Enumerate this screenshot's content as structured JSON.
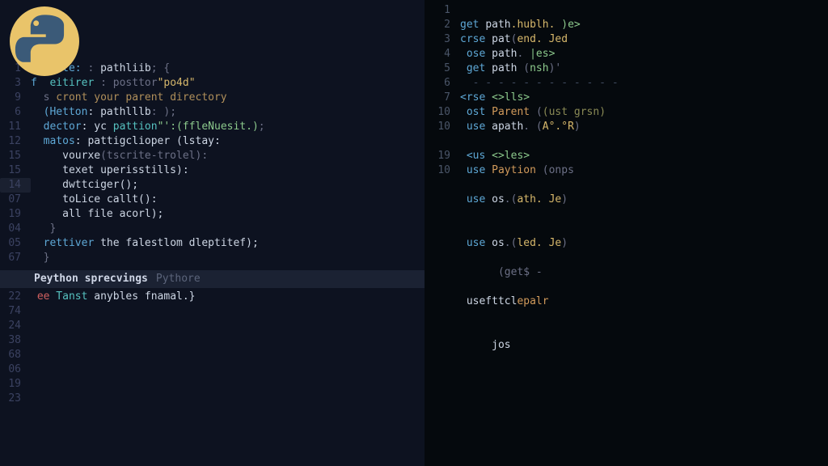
{
  "logo": {
    "name": "python-logo"
  },
  "left": {
    "lines": [
      {
        "n": "",
        "frags": []
      },
      {
        "n": "1",
        "frags": [
          {
            "t": "  rnute:",
            "c": "c-blue"
          },
          {
            "t": " :",
            "c": "c-grey"
          },
          {
            "t": " pathliib",
            "c": "c-white"
          },
          {
            "t": "; {",
            "c": "c-grey"
          }
        ]
      },
      {
        "n": "3",
        "frags": [
          {
            "t": "f",
            "c": "c-blue"
          },
          {
            "t": "  eitirer",
            "c": "c-cyan"
          },
          {
            "t": " : posttor",
            "c": "c-grey"
          },
          {
            "t": "\"po4d\"",
            "c": "c-yellow"
          }
        ]
      },
      {
        "n": "9",
        "frags": [
          {
            "t": "  s",
            "c": "c-grey"
          },
          {
            "t": " cront your parent directory",
            "c": "c-tan"
          }
        ]
      },
      {
        "n": "6",
        "frags": [
          {
            "t": "  (Hetton",
            "c": "c-blue"
          },
          {
            "t": ": pathlllb",
            "c": "c-white"
          },
          {
            "t": ": );",
            "c": "c-grey"
          }
        ]
      },
      {
        "n": "11",
        "frags": [
          {
            "t": "  dector",
            "c": "c-blue"
          },
          {
            "t": ": yc",
            "c": "c-white"
          },
          {
            "t": " pattion",
            "c": "c-cyan"
          },
          {
            "t": "\"':(ffleNuesit.)",
            "c": "c-green"
          },
          {
            "t": ";",
            "c": "c-grey"
          }
        ]
      },
      {
        "n": "12",
        "frags": [
          {
            "t": "  matos",
            "c": "c-blue"
          },
          {
            "t": ": pattigclioper (lstay:",
            "c": "c-white"
          }
        ]
      },
      {
        "n": "15",
        "frags": [
          {
            "t": "     vourxe",
            "c": "c-white"
          },
          {
            "t": "(tscrite-trolel):",
            "c": "c-grey"
          }
        ]
      },
      {
        "n": "15",
        "frags": [
          {
            "t": "     texet uperisstills):",
            "c": "c-white"
          }
        ]
      },
      {
        "n": "14",
        "frags": [
          {
            "t": "     dwttciger();",
            "c": "c-white"
          }
        ],
        "box": true
      },
      {
        "n": "07",
        "frags": [
          {
            "t": "     toLice callt():",
            "c": "c-white"
          }
        ]
      },
      {
        "n": "19",
        "frags": [
          {
            "t": "     all file acorl);",
            "c": "c-white"
          }
        ]
      },
      {
        "n": "04",
        "frags": [
          {
            "t": "   }",
            "c": "c-grey"
          }
        ]
      },
      {
        "n": "05",
        "frags": [
          {
            "t": "  rettiver",
            "c": "c-blue"
          },
          {
            "t": " the falestlom dleptitef);",
            "c": "c-white"
          }
        ]
      },
      {
        "n": "67",
        "frags": [
          {
            "t": "  }",
            "c": "c-grey"
          }
        ]
      }
    ]
  },
  "panel": {
    "title": "Peython sprecvings",
    "subtitle": "Pythore",
    "lines": [
      {
        "n": "22",
        "frags": [
          {
            "t": " ee",
            "c": "c-red"
          },
          {
            "t": " Tanst",
            "c": "c-cyan"
          },
          {
            "t": " anybles fnamal.}",
            "c": "c-white"
          }
        ]
      },
      {
        "n": "74",
        "frags": []
      },
      {
        "n": "24",
        "frags": []
      },
      {
        "n": "38",
        "frags": []
      },
      {
        "n": "68",
        "frags": []
      },
      {
        "n": "06",
        "frags": []
      },
      {
        "n": "19",
        "frags": []
      },
      {
        "n": "23",
        "frags": []
      }
    ]
  },
  "right": {
    "lines": [
      {
        "n": "1",
        "frags": []
      },
      {
        "n": "2",
        "frags": [
          {
            "t": "get ",
            "c": "c-blue"
          },
          {
            "t": "path",
            "c": "c-white"
          },
          {
            "t": ".hublh. ",
            "c": "c-yellow"
          },
          {
            "t": ")e>",
            "c": "c-green"
          }
        ]
      },
      {
        "n": "3",
        "frags": [
          {
            "t": "crse ",
            "c": "c-blue"
          },
          {
            "t": "pat",
            "c": "c-white"
          },
          {
            "t": "(",
            "c": "c-grey"
          },
          {
            "t": "end. Jed",
            "c": "c-yellow"
          }
        ]
      },
      {
        "n": "4",
        "frags": [
          {
            "t": " ose ",
            "c": "c-blue"
          },
          {
            "t": "path",
            "c": "c-white"
          },
          {
            "t": ". ",
            "c": "c-grey"
          },
          {
            "t": "|es>",
            "c": "c-green"
          }
        ]
      },
      {
        "n": "5",
        "frags": [
          {
            "t": " get ",
            "c": "c-blue"
          },
          {
            "t": "path ",
            "c": "c-white"
          },
          {
            "t": "(",
            "c": "c-grey"
          },
          {
            "t": "nsh",
            "c": "c-green"
          },
          {
            "t": ")'",
            "c": "c-grey"
          }
        ]
      },
      {
        "n": "6",
        "frags": [
          {
            "t": "  - - - - - - - - - - - -",
            "c": "c-dim"
          }
        ]
      },
      {
        "n": "7",
        "frags": [
          {
            "t": "<rse ",
            "c": "c-blue"
          },
          {
            "t": "<>lls>",
            "c": "c-green"
          }
        ]
      },
      {
        "n": "10",
        "frags": [
          {
            "t": " ost ",
            "c": "c-blue"
          },
          {
            "t": "Parent ",
            "c": "c-orange"
          },
          {
            "t": "(",
            "c": "c-grey"
          },
          {
            "t": "(ust grsn)",
            "c": "c-olive"
          }
        ]
      },
      {
        "n": "10",
        "frags": [
          {
            "t": " use ",
            "c": "c-blue"
          },
          {
            "t": "apath",
            "c": "c-white"
          },
          {
            "t": ". (",
            "c": "c-grey"
          },
          {
            "t": "A°.°R",
            "c": "c-yellow"
          },
          {
            "t": ")",
            "c": "c-grey"
          }
        ]
      },
      {
        "n": "",
        "frags": []
      },
      {
        "n": "19",
        "frags": [
          {
            "t": " <us ",
            "c": "c-blue"
          },
          {
            "t": "<>les>",
            "c": "c-green"
          }
        ]
      },
      {
        "n": "10",
        "frags": [
          {
            "t": " use ",
            "c": "c-blue"
          },
          {
            "t": "Paytion ",
            "c": "c-orange"
          },
          {
            "t": "(onps",
            "c": "c-grey"
          }
        ]
      },
      {
        "n": "",
        "frags": []
      },
      {
        "n": "",
        "frags": [
          {
            "t": " use ",
            "c": "c-blue"
          },
          {
            "t": "os",
            "c": "c-white"
          },
          {
            "t": ".(",
            "c": "c-grey"
          },
          {
            "t": "ath. Je",
            "c": "c-yellow"
          },
          {
            "t": ")",
            "c": "c-grey"
          }
        ]
      },
      {
        "n": "",
        "frags": []
      },
      {
        "n": "",
        "frags": []
      },
      {
        "n": "",
        "frags": [
          {
            "t": " use ",
            "c": "c-blue"
          },
          {
            "t": "os",
            "c": "c-white"
          },
          {
            "t": ".(",
            "c": "c-grey"
          },
          {
            "t": "led. Je",
            "c": "c-yellow"
          },
          {
            "t": ")",
            "c": "c-grey"
          }
        ]
      },
      {
        "n": "",
        "frags": []
      },
      {
        "n": "",
        "frags": [
          {
            "t": "      (get$ -",
            "c": "c-grey"
          }
        ]
      },
      {
        "n": "",
        "frags": []
      },
      {
        "n": "",
        "frags": [
          {
            "t": " usefttcl",
            "c": "c-white"
          },
          {
            "t": "epalr",
            "c": "c-orange"
          }
        ]
      },
      {
        "n": "",
        "frags": []
      },
      {
        "n": "",
        "frags": []
      },
      {
        "n": "",
        "frags": [
          {
            "t": "     jos",
            "c": "c-white"
          }
        ]
      }
    ]
  }
}
